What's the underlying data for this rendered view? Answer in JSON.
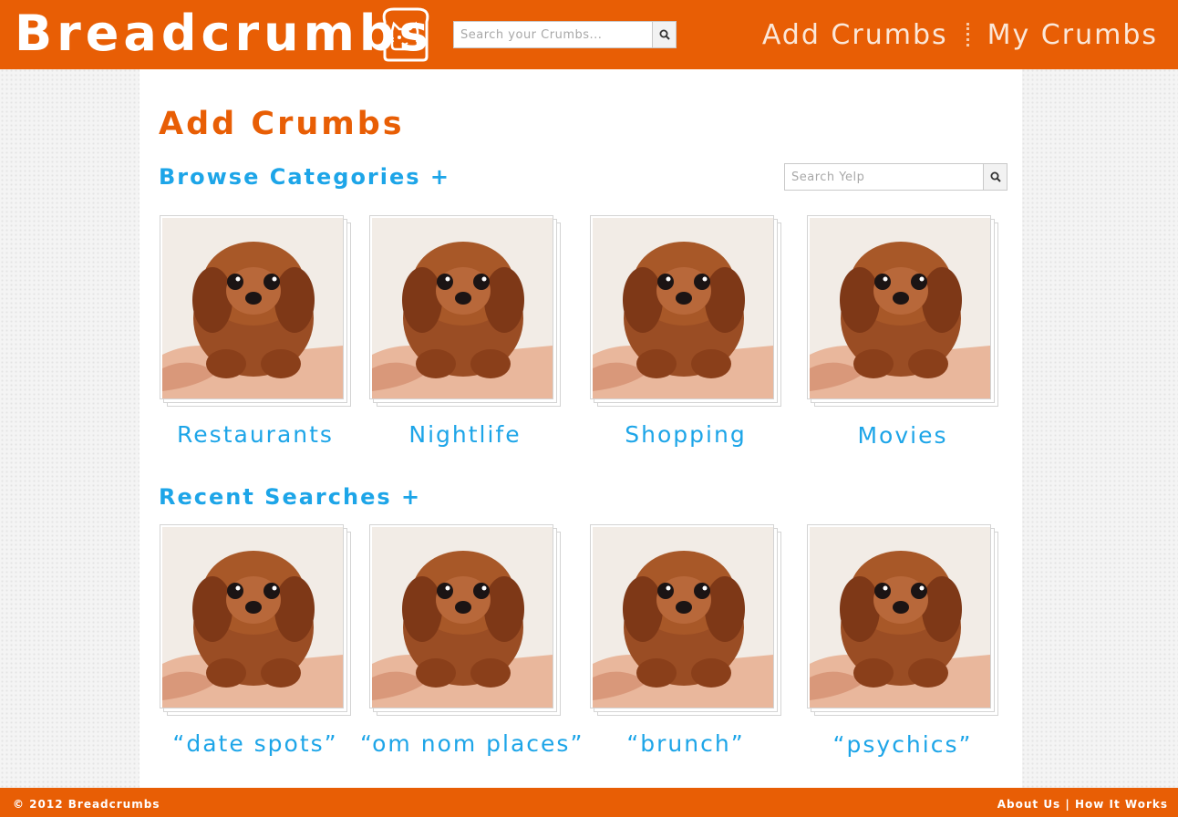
{
  "header": {
    "logo_text": "Breadcrumbs",
    "search_placeholder": "Search your Crumbs...",
    "nav": {
      "add_crumbs": "Add Crumbs",
      "my_crumbs": "My Crumbs"
    }
  },
  "main": {
    "title": "Add Crumbs",
    "browse_heading": "Browse Categories +",
    "yelp_search_placeholder": "Search Yelp",
    "categories": [
      {
        "label": "Restaurants"
      },
      {
        "label": "Nightlife"
      },
      {
        "label": "Shopping"
      },
      {
        "label": "Movies"
      }
    ],
    "recent_heading": "Recent Searches +",
    "recent_searches": [
      {
        "label": "“date spots”"
      },
      {
        "label": "“om nom places”"
      },
      {
        "label": "“brunch”"
      },
      {
        "label": "“psychics”"
      }
    ]
  },
  "footer": {
    "copyright": "© 2012 Breadcrumbs",
    "about": "About Us",
    "separator": "|",
    "how_it_works": "How It Works"
  },
  "colors": {
    "brand_orange": "#e85e05",
    "accent_blue": "#1da5e8"
  },
  "icons": {
    "logo": "cat-toast-logo-icon",
    "search": "search-icon"
  }
}
